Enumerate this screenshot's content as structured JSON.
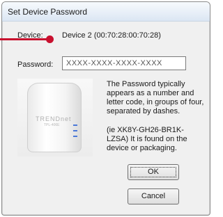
{
  "window": {
    "title": "Set Device Password"
  },
  "device": {
    "label": "Device:",
    "value": "Device 2  (00:70:28:00:70:28)"
  },
  "password": {
    "label": "Password:",
    "value": "XXXX-XXXX-XXXX-XXXX"
  },
  "help": {
    "description": "The Password typically appears as a number and letter code, in groups of four, separated by dashes.",
    "example": "(ie XK8Y-GH26-BR1K-LZSA) It is found on the device or packaging."
  },
  "device_image": {
    "brand": "TRENDnet",
    "model": "TPL-406E"
  },
  "buttons": {
    "ok": "OK",
    "cancel": "Cancel"
  },
  "colors": {
    "callout": "#c8102e",
    "led": "#4a78d8"
  }
}
